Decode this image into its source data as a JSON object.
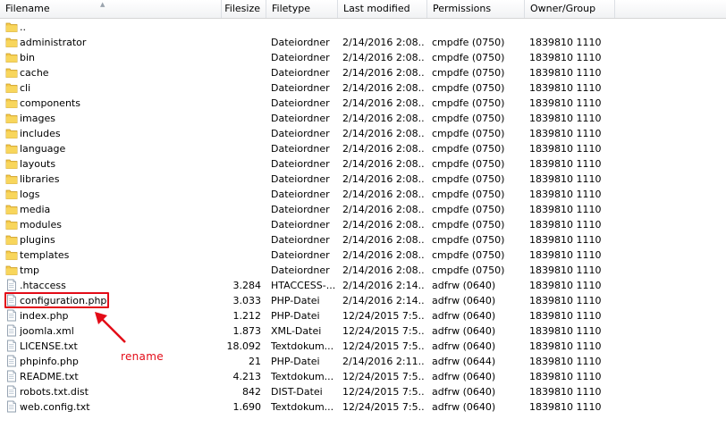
{
  "columns": {
    "filename": "Filename",
    "filesize": "Filesize",
    "filetype": "Filetype",
    "last_modified": "Last modified",
    "permissions": "Permissions",
    "owner_group": "Owner/Group"
  },
  "files": [
    {
      "name": "..",
      "size": "",
      "type": "",
      "modified": "",
      "perms": "",
      "owner": "",
      "icon": "folder-icon"
    },
    {
      "name": "administrator",
      "size": "",
      "type": "Dateiordner",
      "modified": "2/14/2016 2:08...",
      "perms": "cmpdfe (0750)",
      "owner": "1839810 1110",
      "icon": "folder-icon"
    },
    {
      "name": "bin",
      "size": "",
      "type": "Dateiordner",
      "modified": "2/14/2016 2:08...",
      "perms": "cmpdfe (0750)",
      "owner": "1839810 1110",
      "icon": "folder-icon"
    },
    {
      "name": "cache",
      "size": "",
      "type": "Dateiordner",
      "modified": "2/14/2016 2:08...",
      "perms": "cmpdfe (0750)",
      "owner": "1839810 1110",
      "icon": "folder-icon"
    },
    {
      "name": "cli",
      "size": "",
      "type": "Dateiordner",
      "modified": "2/14/2016 2:08...",
      "perms": "cmpdfe (0750)",
      "owner": "1839810 1110",
      "icon": "folder-icon"
    },
    {
      "name": "components",
      "size": "",
      "type": "Dateiordner",
      "modified": "2/14/2016 2:08...",
      "perms": "cmpdfe (0750)",
      "owner": "1839810 1110",
      "icon": "folder-icon"
    },
    {
      "name": "images",
      "size": "",
      "type": "Dateiordner",
      "modified": "2/14/2016 2:08...",
      "perms": "cmpdfe (0750)",
      "owner": "1839810 1110",
      "icon": "folder-icon"
    },
    {
      "name": "includes",
      "size": "",
      "type": "Dateiordner",
      "modified": "2/14/2016 2:08...",
      "perms": "cmpdfe (0750)",
      "owner": "1839810 1110",
      "icon": "folder-icon"
    },
    {
      "name": "language",
      "size": "",
      "type": "Dateiordner",
      "modified": "2/14/2016 2:08...",
      "perms": "cmpdfe (0750)",
      "owner": "1839810 1110",
      "icon": "folder-icon"
    },
    {
      "name": "layouts",
      "size": "",
      "type": "Dateiordner",
      "modified": "2/14/2016 2:08...",
      "perms": "cmpdfe (0750)",
      "owner": "1839810 1110",
      "icon": "folder-icon"
    },
    {
      "name": "libraries",
      "size": "",
      "type": "Dateiordner",
      "modified": "2/14/2016 2:08...",
      "perms": "cmpdfe (0750)",
      "owner": "1839810 1110",
      "icon": "folder-icon"
    },
    {
      "name": "logs",
      "size": "",
      "type": "Dateiordner",
      "modified": "2/14/2016 2:08...",
      "perms": "cmpdfe (0750)",
      "owner": "1839810 1110",
      "icon": "folder-icon"
    },
    {
      "name": "media",
      "size": "",
      "type": "Dateiordner",
      "modified": "2/14/2016 2:08...",
      "perms": "cmpdfe (0750)",
      "owner": "1839810 1110",
      "icon": "folder-icon"
    },
    {
      "name": "modules",
      "size": "",
      "type": "Dateiordner",
      "modified": "2/14/2016 2:08...",
      "perms": "cmpdfe (0750)",
      "owner": "1839810 1110",
      "icon": "folder-icon"
    },
    {
      "name": "plugins",
      "size": "",
      "type": "Dateiordner",
      "modified": "2/14/2016 2:08...",
      "perms": "cmpdfe (0750)",
      "owner": "1839810 1110",
      "icon": "folder-icon"
    },
    {
      "name": "templates",
      "size": "",
      "type": "Dateiordner",
      "modified": "2/14/2016 2:08...",
      "perms": "cmpdfe (0750)",
      "owner": "1839810 1110",
      "icon": "folder-icon"
    },
    {
      "name": "tmp",
      "size": "",
      "type": "Dateiordner",
      "modified": "2/14/2016 2:08...",
      "perms": "cmpdfe (0750)",
      "owner": "1839810 1110",
      "icon": "folder-icon"
    },
    {
      "name": ".htaccess",
      "size": "3.284",
      "type": "HTACCESS-...",
      "modified": "2/14/2016 2:14...",
      "perms": "adfrw (0640)",
      "owner": "1839810 1110",
      "icon": "file-icon"
    },
    {
      "name": "configuration.php",
      "size": "3.033",
      "type": "PHP-Datei",
      "modified": "2/14/2016 2:14...",
      "perms": "adfrw (0640)",
      "owner": "1839810 1110",
      "icon": "file-icon"
    },
    {
      "name": "index.php",
      "size": "1.212",
      "type": "PHP-Datei",
      "modified": "12/24/2015 7:5...",
      "perms": "adfrw (0640)",
      "owner": "1839810 1110",
      "icon": "file-icon"
    },
    {
      "name": "joomla.xml",
      "size": "1.873",
      "type": "XML-Datei",
      "modified": "12/24/2015 7:5...",
      "perms": "adfrw (0640)",
      "owner": "1839810 1110",
      "icon": "file-icon"
    },
    {
      "name": "LICENSE.txt",
      "size": "18.092",
      "type": "Textdokum...",
      "modified": "12/24/2015 7:5...",
      "perms": "adfrw (0640)",
      "owner": "1839810 1110",
      "icon": "file-icon"
    },
    {
      "name": "phpinfo.php",
      "size": "21",
      "type": "PHP-Datei",
      "modified": "2/14/2016 2:11...",
      "perms": "adfrw (0644)",
      "owner": "1839810 1110",
      "icon": "file-icon"
    },
    {
      "name": "README.txt",
      "size": "4.213",
      "type": "Textdokum...",
      "modified": "12/24/2015 7:5...",
      "perms": "adfrw (0640)",
      "owner": "1839810 1110",
      "icon": "file-icon"
    },
    {
      "name": "robots.txt.dist",
      "size": "842",
      "type": "DIST-Datei",
      "modified": "12/24/2015 7:5...",
      "perms": "adfrw (0640)",
      "owner": "1839810 1110",
      "icon": "file-icon"
    },
    {
      "name": "web.config.txt",
      "size": "1.690",
      "type": "Textdokum...",
      "modified": "12/24/2015 7:5...",
      "perms": "adfrw (0640)",
      "owner": "1839810 1110",
      "icon": "file-icon"
    }
  ],
  "annotation": {
    "label": "rename",
    "color": "#e30b17",
    "highlighted_file": "configuration.php"
  }
}
